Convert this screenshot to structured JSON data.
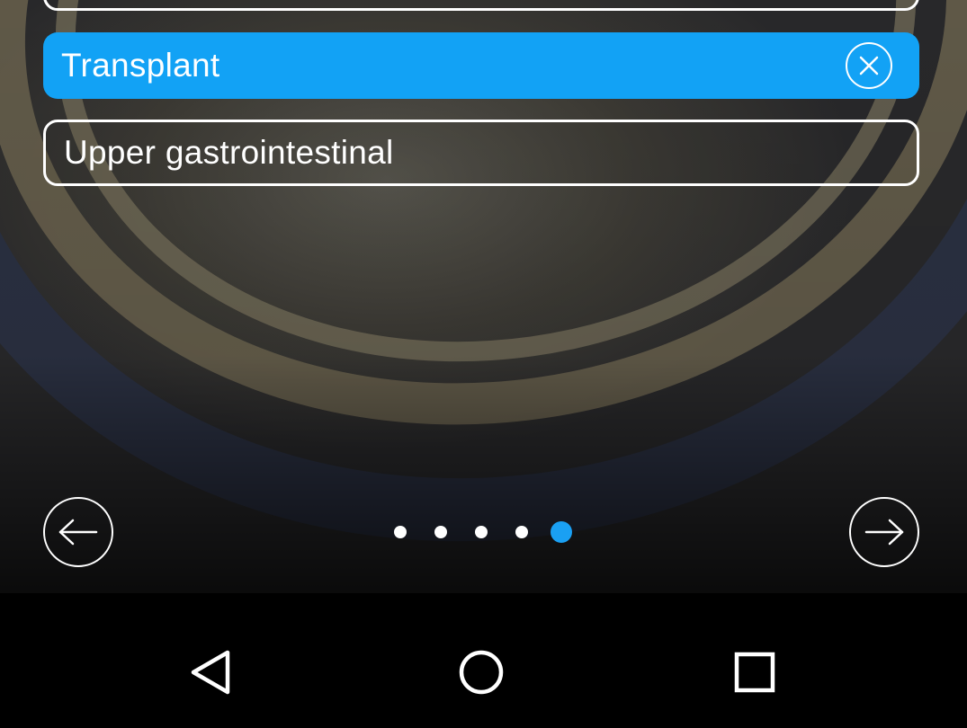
{
  "options": {
    "transplant_label": "Transplant",
    "upper_gi_label": "Upper gastrointestinal"
  },
  "icons": {
    "clear": "close-icon",
    "prev": "arrow-left-icon",
    "next": "arrow-right-icon",
    "back": "triangle-back-icon",
    "home": "circle-home-icon",
    "recents": "square-recents-icon"
  },
  "pager": {
    "total_pages": 5,
    "current_page": 5
  },
  "colors": {
    "accent": "#12a2f5",
    "text": "#ffffff",
    "system_bar": "#000000"
  }
}
